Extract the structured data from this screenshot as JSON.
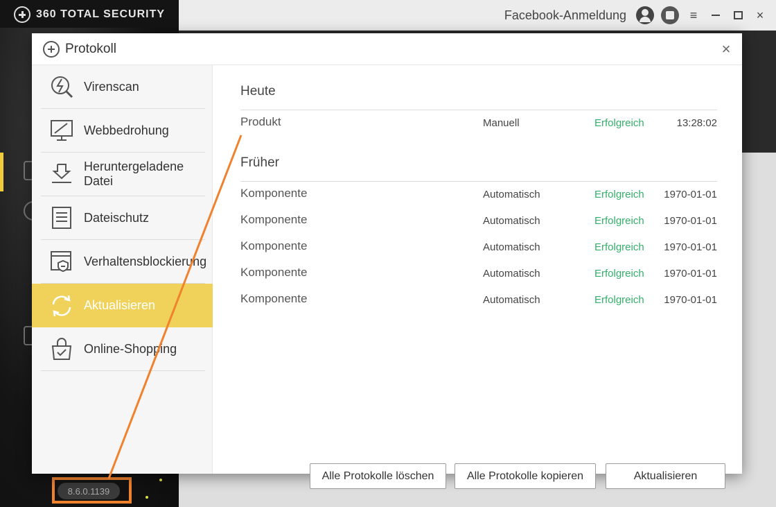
{
  "app": {
    "brand": "360 TOTAL SECURITY",
    "facebook_login": "Facebook-Anmeldung",
    "version": "8.6.0.1139"
  },
  "dialog": {
    "title": "Protokoll",
    "close": "×"
  },
  "nav": [
    {
      "label": "Virenscan",
      "icon": "virus-scan-icon"
    },
    {
      "label": "Webbedrohung",
      "icon": "web-threat-icon"
    },
    {
      "label": "Heruntergeladene Datei",
      "icon": "download-icon"
    },
    {
      "label": "Dateischutz",
      "icon": "file-protection-icon"
    },
    {
      "label": "Verhaltensblockierung",
      "icon": "behavior-block-icon"
    },
    {
      "label": "Aktualisieren",
      "icon": "update-icon",
      "active": true
    },
    {
      "label": "Online-Shopping",
      "icon": "shopping-bag-icon"
    }
  ],
  "today": {
    "title": "Heute",
    "rows": [
      {
        "name": "Produkt",
        "mode": "Manuell",
        "status": "Erfolgreich",
        "time": "13:28:02"
      }
    ]
  },
  "earlier": {
    "title": "Früher",
    "rows": [
      {
        "name": "Komponente",
        "mode": "Automatisch",
        "status": "Erfolgreich",
        "time": "1970-01-01"
      },
      {
        "name": "Komponente",
        "mode": "Automatisch",
        "status": "Erfolgreich",
        "time": "1970-01-01"
      },
      {
        "name": "Komponente",
        "mode": "Automatisch",
        "status": "Erfolgreich",
        "time": "1970-01-01"
      },
      {
        "name": "Komponente",
        "mode": "Automatisch",
        "status": "Erfolgreich",
        "time": "1970-01-01"
      },
      {
        "name": "Komponente",
        "mode": "Automatisch",
        "status": "Erfolgreich",
        "time": "1970-01-01"
      }
    ]
  },
  "buttons": {
    "clear_all": "Alle Protokolle löschen",
    "copy_all": "Alle Protokolle kopieren",
    "refresh": "Aktualisieren"
  },
  "colors": {
    "accent_yellow": "#f0d25a",
    "success_green": "#34b06a",
    "annotation_orange": "#f0822e"
  }
}
